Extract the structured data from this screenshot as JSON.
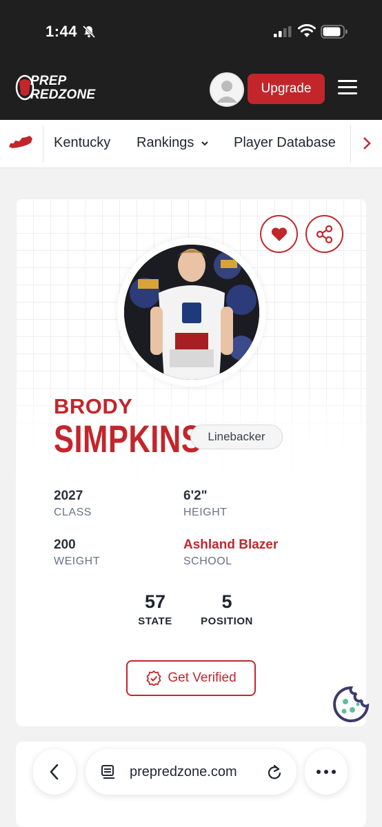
{
  "status_bar": {
    "time": "1:44"
  },
  "header": {
    "logo_line1": "PREP",
    "logo_line2": "REDZONE",
    "upgrade_label": "Upgrade"
  },
  "nav": {
    "items": [
      {
        "label": "Kentucky"
      },
      {
        "label": "Rankings"
      },
      {
        "label": "Player Database"
      }
    ]
  },
  "player": {
    "first_name": "BRODY",
    "last_name": "SIMPKINS",
    "position": "Linebacker",
    "class_value": "2027",
    "class_label": "CLASS",
    "height_value": "6'2\"",
    "height_label": "HEIGHT",
    "weight_value": "200",
    "weight_label": "WEIGHT",
    "school_value": "Ashland Blazer",
    "school_label": "SCHOOL"
  },
  "rankings": {
    "state_value": "57",
    "state_label": "STATE",
    "position_value": "5",
    "position_label": "POSITION"
  },
  "actions": {
    "verify_label": "Get Verified"
  },
  "browser": {
    "url": "prepredzone.com"
  },
  "colors": {
    "brand_red": "#c2262b",
    "header_bg": "#1f1f20",
    "text_dark": "#1f2430",
    "muted": "#6a7280"
  },
  "icons": [
    "bell-slash-icon",
    "signal-icon",
    "wifi-icon",
    "battery-icon",
    "kentucky-state-icon",
    "chevron-down-icon",
    "chevron-right-icon",
    "heart-icon",
    "share-icon",
    "verified-badge-icon",
    "cookie-icon",
    "back-icon",
    "tabs-icon",
    "reload-icon",
    "more-icon"
  ]
}
